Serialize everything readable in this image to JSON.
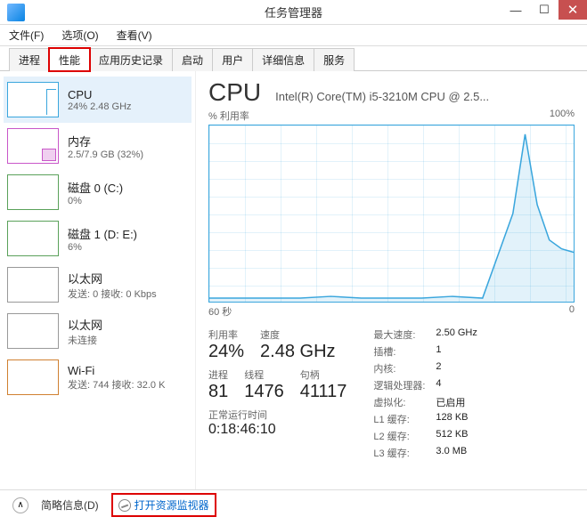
{
  "window": {
    "title": "任务管理器"
  },
  "menu": {
    "file": "文件(F)",
    "options": "选项(O)",
    "view": "查看(V)"
  },
  "tabs": {
    "processes": "进程",
    "performance": "性能",
    "app_history": "应用历史记录",
    "startup": "启动",
    "users": "用户",
    "details": "详细信息",
    "services": "服务"
  },
  "sidebar": {
    "cpu": {
      "title": "CPU",
      "sub": "24% 2.48 GHz"
    },
    "mem": {
      "title": "内存",
      "sub": "2.5/7.9 GB (32%)"
    },
    "disk0": {
      "title": "磁盘 0 (C:)",
      "sub": "0%"
    },
    "disk1": {
      "title": "磁盘 1 (D: E:)",
      "sub": "6%"
    },
    "eth0": {
      "title": "以太网",
      "sub": "发送: 0 接收: 0 Kbps"
    },
    "eth1": {
      "title": "以太网",
      "sub": "未连接"
    },
    "wifi": {
      "title": "Wi-Fi",
      "sub": "发送: 744 接收: 32.0 K"
    }
  },
  "detail": {
    "heading": "CPU",
    "subtitle": "Intel(R) Core(TM) i5-3210M CPU @ 2.5...",
    "ylabel": "% 利用率",
    "ymax": "100%",
    "xlabel_left": "60 秒",
    "xlabel_right": "0",
    "util_label": "利用率",
    "util_val": "24%",
    "speed_label": "速度",
    "speed_val": "2.48 GHz",
    "proc_label": "进程",
    "proc_val": "81",
    "thread_label": "线程",
    "thread_val": "1476",
    "handle_label": "句柄",
    "handle_val": "41117",
    "uptime_label": "正常运行时间",
    "uptime_val": "0:18:46:10",
    "kv": {
      "maxspeed_k": "最大速度:",
      "maxspeed_v": "2.50 GHz",
      "sockets_k": "插槽:",
      "sockets_v": "1",
      "cores_k": "内核:",
      "cores_v": "2",
      "logical_k": "逻辑处理器:",
      "logical_v": "4",
      "virt_k": "虚拟化:",
      "virt_v": "已启用",
      "l1_k": "L1 缓存:",
      "l1_v": "128 KB",
      "l2_k": "L2 缓存:",
      "l2_v": "512 KB",
      "l3_k": "L3 缓存:",
      "l3_v": "3.0 MB"
    }
  },
  "footer": {
    "brief": "简略信息(D)",
    "resmon": "打开资源监视器"
  },
  "chart_data": {
    "type": "line",
    "title": "% 利用率",
    "ylabel": "% 利用率",
    "ylim": [
      0,
      100
    ],
    "xlabel": "60 秒 → 0",
    "x_seconds": [
      60,
      55,
      50,
      45,
      40,
      35,
      30,
      25,
      20,
      15,
      10,
      8,
      6,
      4,
      2,
      0
    ],
    "values": [
      2,
      2,
      2,
      2,
      3,
      2,
      2,
      2,
      3,
      2,
      50,
      95,
      55,
      35,
      30,
      28
    ]
  }
}
